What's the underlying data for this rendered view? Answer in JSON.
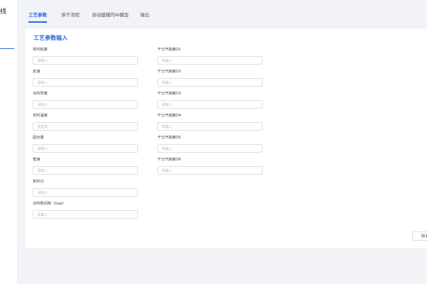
{
  "sidebar": {
    "title_char": "线"
  },
  "tabs": [
    {
      "label": "工艺参数"
    },
    {
      "label": "烘干流程"
    },
    {
      "label": "自动建模的AI模型"
    },
    {
      "label": "输出"
    }
  ],
  "card": {
    "title": "工艺参数输入"
  },
  "left_fields": [
    {
      "label": "浆料粘度",
      "placeholder": "请输入"
    },
    {
      "label": "走速",
      "placeholder": "请输入"
    },
    {
      "label": "涂布厚度",
      "placeholder": "请输入"
    },
    {
      "label": "浆料温度",
      "placeholder": "请选择"
    },
    {
      "label": "固含量",
      "placeholder": "请输入"
    },
    {
      "label": "宽速",
      "placeholder": "请输入"
    },
    {
      "label": "浆料口",
      "placeholder": "请输入"
    },
    {
      "label": "涂布辊间隙（Gap）",
      "placeholder": "请输入"
    }
  ],
  "right_fields": [
    {
      "label": "干分汽高度D1",
      "placeholder": "请输入"
    },
    {
      "label": "干分汽高度D2",
      "placeholder": "请输入"
    },
    {
      "label": "干分汽高度D3",
      "placeholder": "请输入"
    },
    {
      "label": "干分汽高度D4",
      "placeholder": "请输入"
    },
    {
      "label": "干分汽高度D5",
      "placeholder": "请输入"
    },
    {
      "label": "干分汽高度D6",
      "placeholder": "请输入"
    }
  ],
  "actions": {
    "cancel_label": "取消"
  }
}
